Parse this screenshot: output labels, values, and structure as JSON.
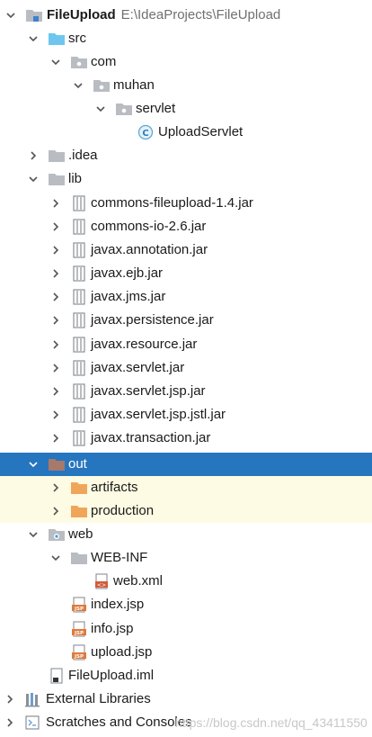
{
  "project": {
    "name": "FileUpload",
    "path": "E:\\IdeaProjects\\FileUpload"
  },
  "nodes": {
    "src": "src",
    "com": "com",
    "muhan": "muhan",
    "servlet": "servlet",
    "upload_servlet": "UploadServlet",
    "idea": ".idea",
    "lib": "lib",
    "jars": [
      "commons-fileupload-1.4.jar",
      "commons-io-2.6.jar",
      "javax.annotation.jar",
      "javax.ejb.jar",
      "javax.jms.jar",
      "javax.persistence.jar",
      "javax.resource.jar",
      "javax.servlet.jar",
      "javax.servlet.jsp.jar",
      "javax.servlet.jsp.jstl.jar",
      "javax.transaction.jar"
    ],
    "out": "out",
    "artifacts": "artifacts",
    "production": "production",
    "web": "web",
    "web_inf": "WEB-INF",
    "web_xml": "web.xml",
    "index_jsp": "index.jsp",
    "info_jsp": "info.jsp",
    "upload_jsp": "upload.jsp",
    "iml": "FileUpload.iml",
    "external_libraries": "External Libraries",
    "scratches": "Scratches and Consoles"
  },
  "watermark": "https://blog.csdn.net/qq_43411550",
  "colors": {
    "selection": "#2675bf",
    "highlight": "#fdfbe3",
    "folder": "#b9bdc2",
    "source_folder": "#6ec6ef",
    "excluded_folder": "#a6796a",
    "orange_folder": "#f0a65a"
  }
}
